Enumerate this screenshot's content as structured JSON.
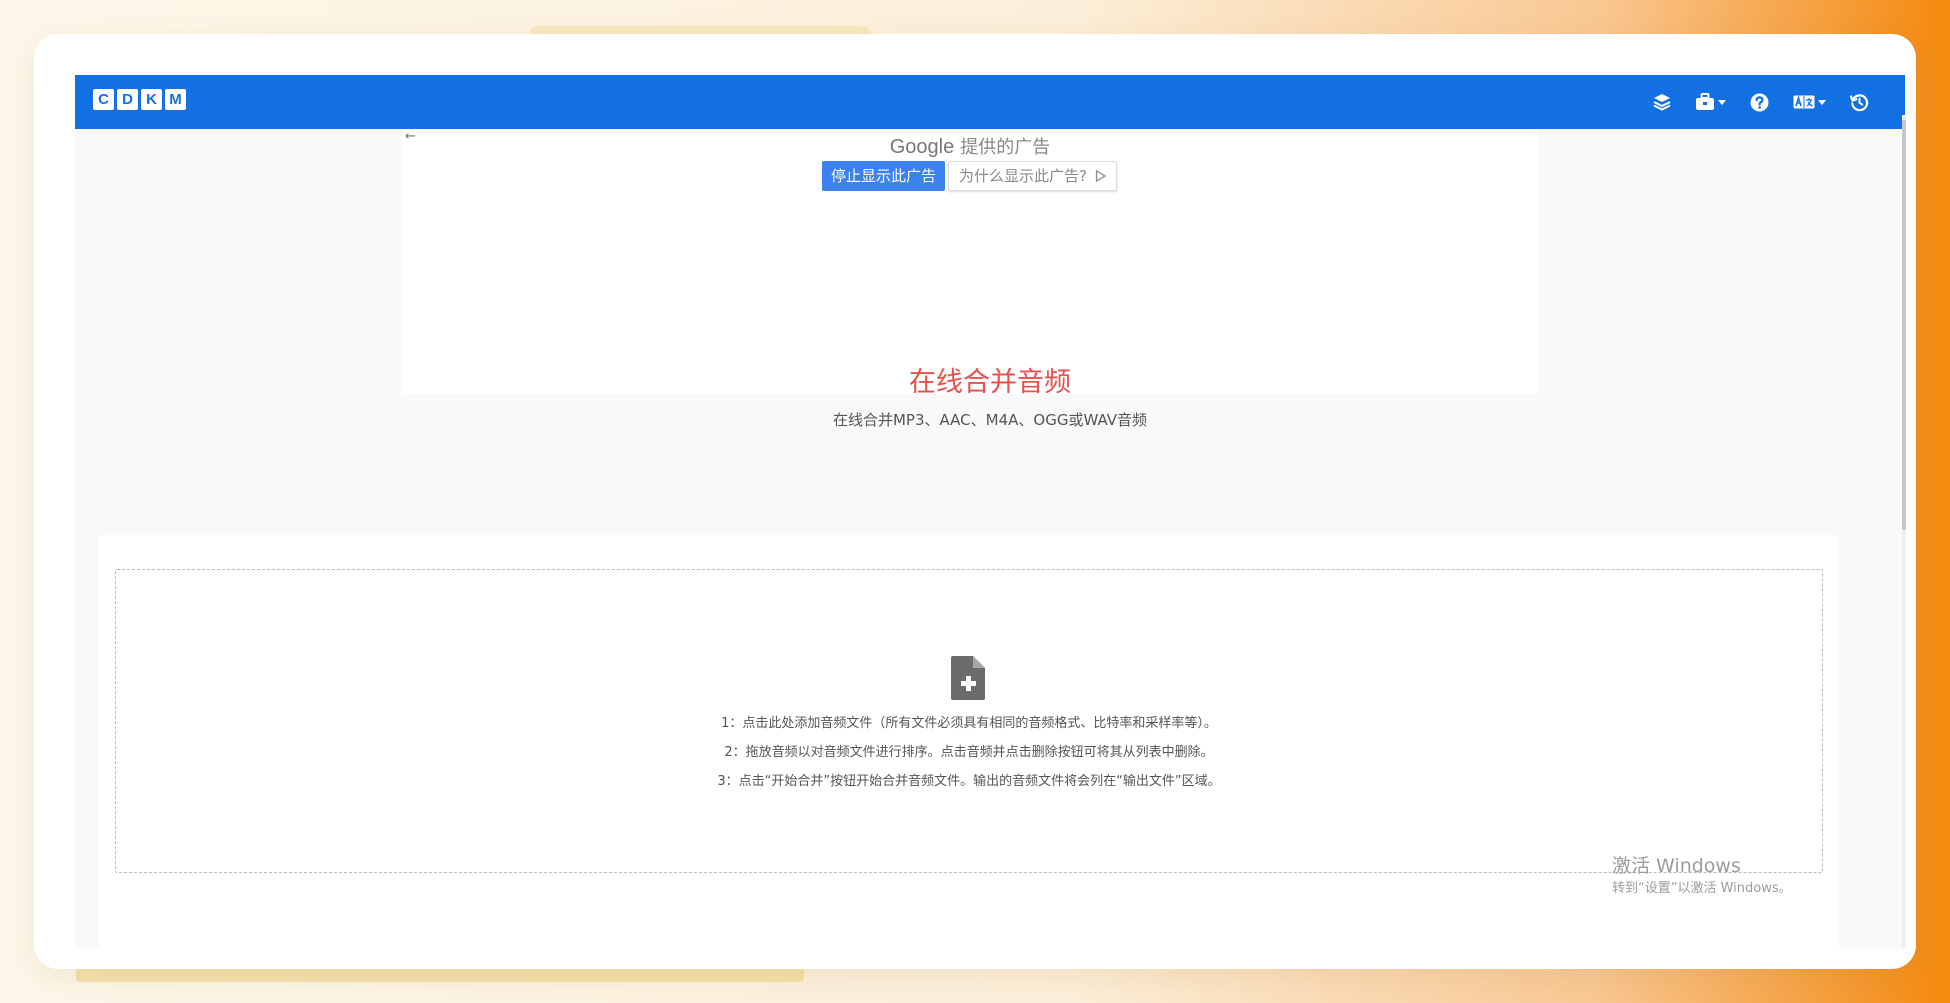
{
  "logo": {
    "letters": [
      "C",
      "D",
      "K",
      "M"
    ]
  },
  "navbar": {
    "icons": [
      "layers-icon",
      "toolbox-icon",
      "help-icon",
      "translate-icon",
      "history-icon"
    ],
    "color": "#1270e3"
  },
  "ad": {
    "back_arrow": "←",
    "brand": "Google",
    "suffix": "提供的广告",
    "stop_label": "停止显示此广告",
    "why_label": "为什么显示此广告?"
  },
  "page": {
    "title": "在线合并音频",
    "subtitle": "在线合并MP3、AAC、M4A、OGG或WAV音频",
    "title_color": "#e8504b"
  },
  "dropzone": {
    "icon": "file-add-icon",
    "instructions": [
      "1：点击此处添加音频文件（所有文件必须具有相同的音频格式、比特率和采样率等）。",
      "2：拖放音频以对音频文件进行排序。点击音频并点击删除按钮可将其从列表中删除。",
      "3：点击“开始合并”按钮开始合并音频文件。输出的音频文件将会列在“输出文件”区域。"
    ]
  },
  "watermark": {
    "title": "激活 Windows",
    "subtitle": "转到“设置”以激活 Windows。"
  }
}
